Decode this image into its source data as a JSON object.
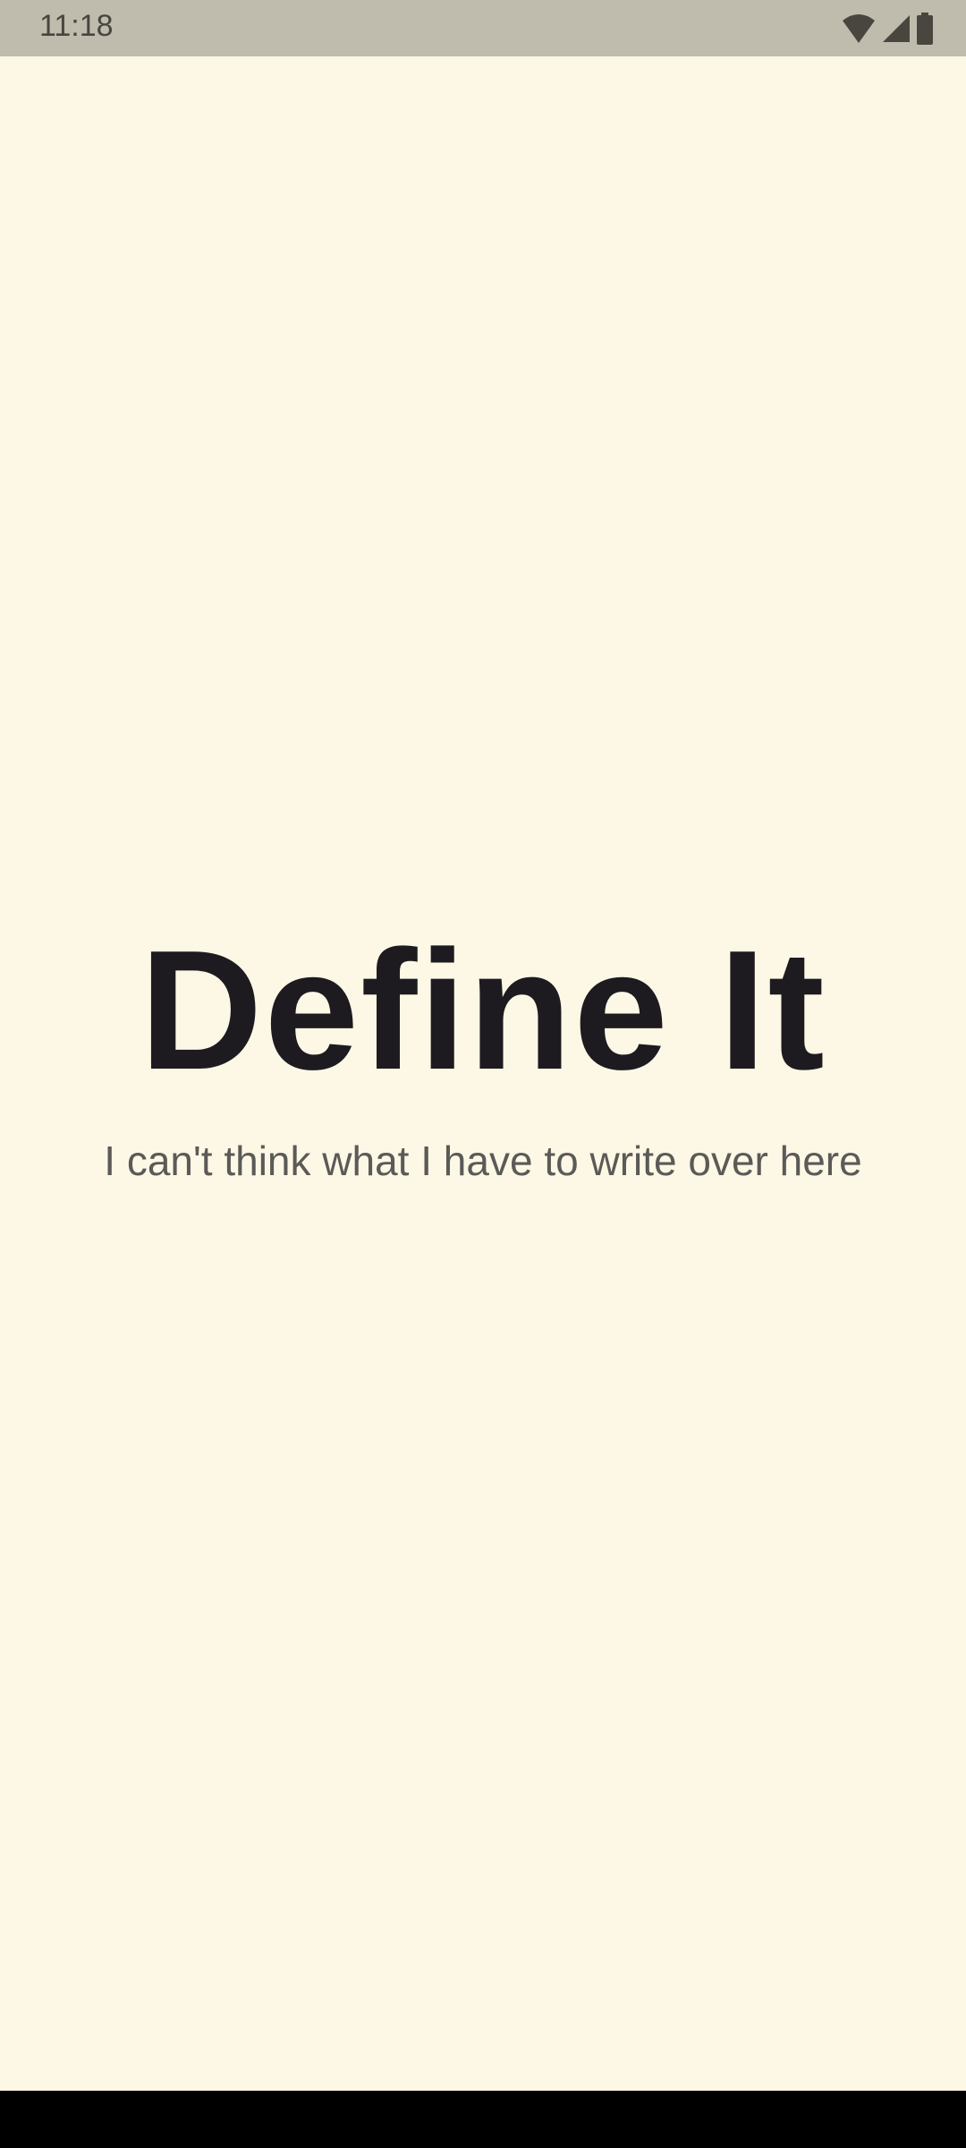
{
  "status_bar": {
    "time": "11:18",
    "icons": [
      "wifi-icon",
      "signal-icon",
      "battery-icon"
    ]
  },
  "main": {
    "title": "Define It",
    "subtitle": "I can't think what I have to write over here"
  },
  "colors": {
    "background": "#fdf8e6",
    "status_bar": "#bfbcae",
    "title": "#1d1b20",
    "subtitle": "#5b5a57"
  }
}
